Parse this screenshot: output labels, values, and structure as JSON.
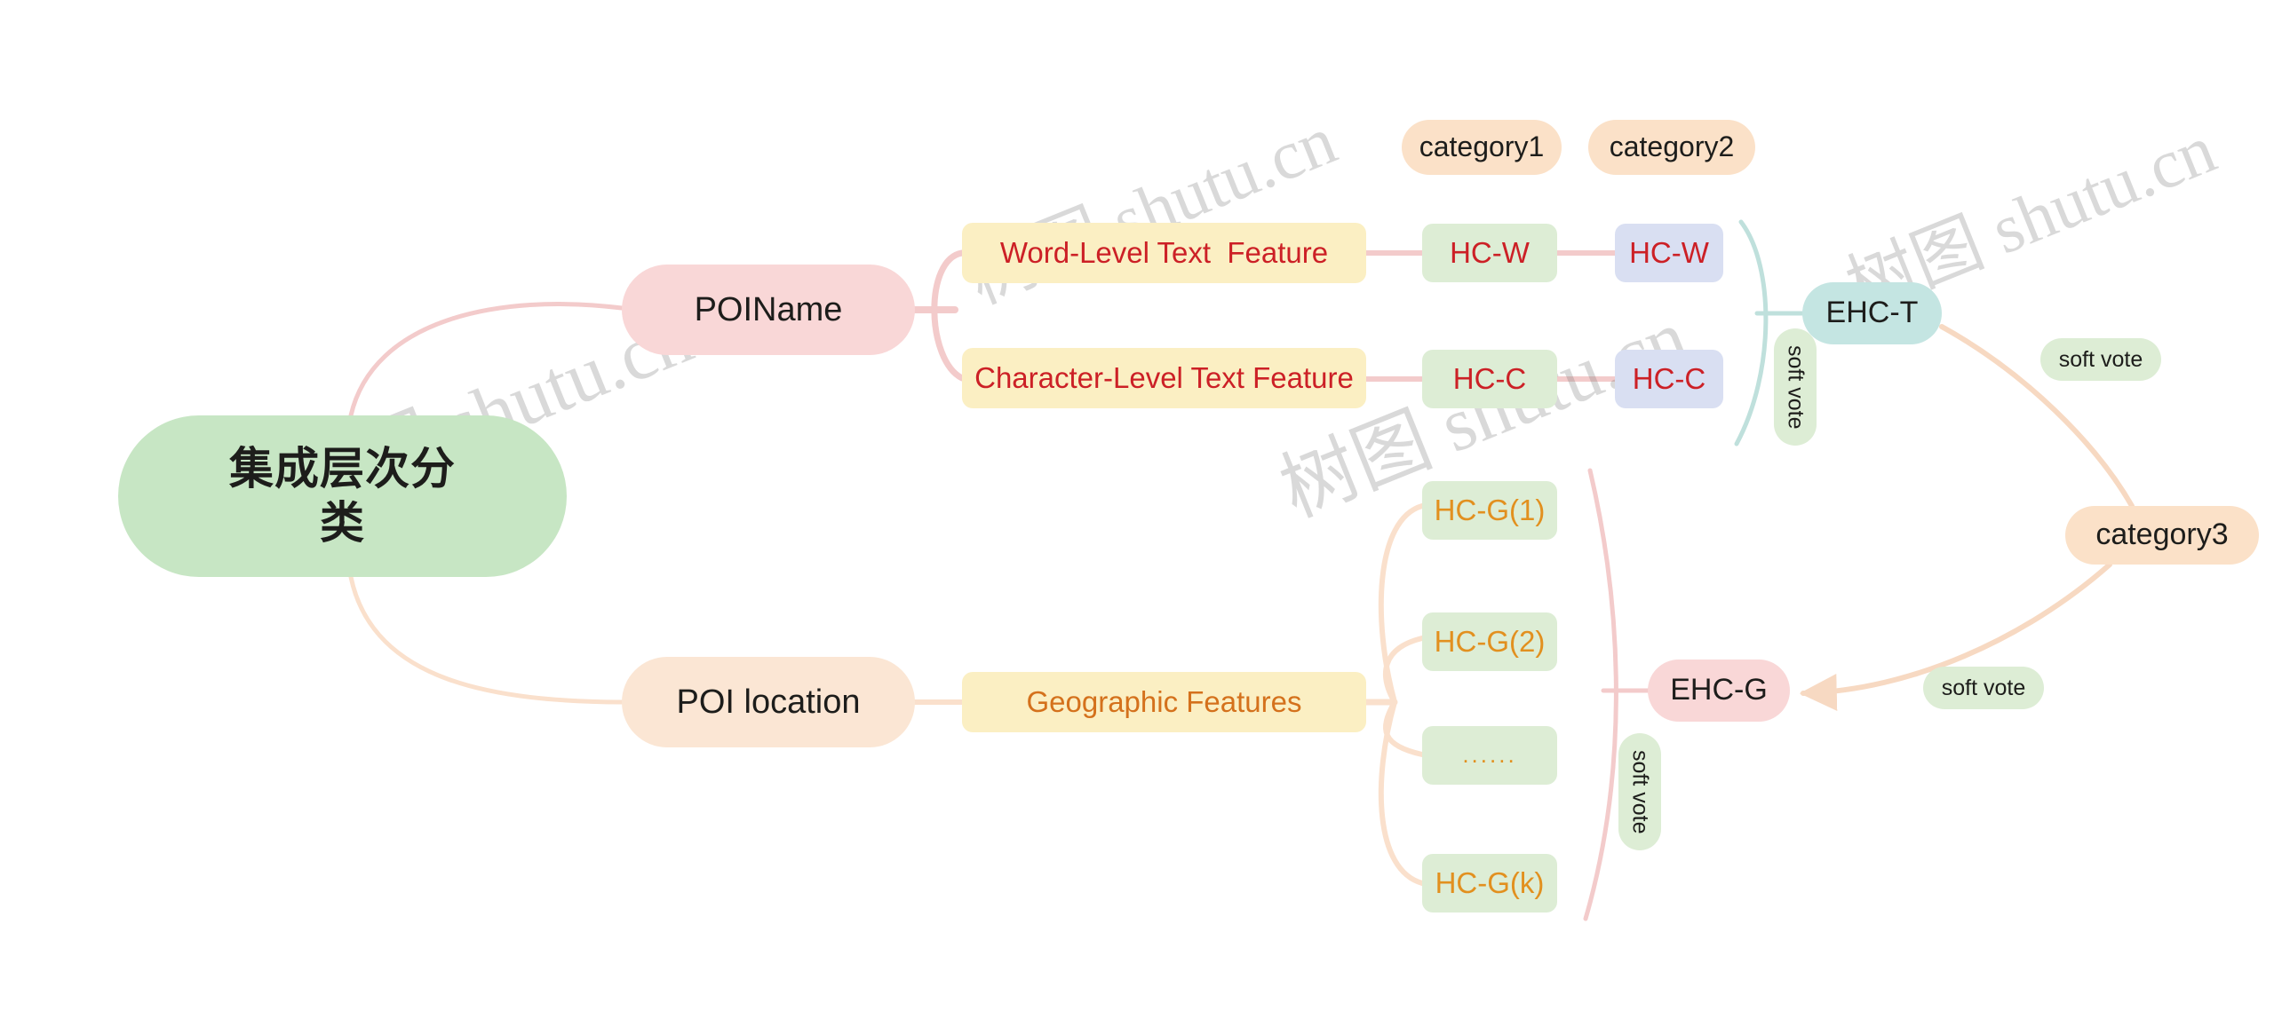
{
  "diagram": {
    "title": "集成层次分类",
    "watermark": "树图 shutu.cn",
    "colors": {
      "root_fill": "#c7e6c4",
      "poiname_fill": "#f9d7d7",
      "poilocation_fill": "#fbe6d4",
      "feature_fill": "#fbefc3",
      "hc_fill": "#ddedd5",
      "hc_blue_fill": "#d9dff2",
      "ehct_fill": "#c4e5e2",
      "ehcg_fill": "#f9d7d7",
      "category_fill": "#fbe1c8",
      "softvote_fill": "#ddedd5",
      "text_red": "#cc2026",
      "text_orange": "#d4711c",
      "text_amber": "#e2901f",
      "edge_pink": "#f3cbcb",
      "edge_peach": "#fae0cc",
      "edge_teal": "#bfe0dc",
      "edge_arrow": "#f7d9c2"
    }
  },
  "root": {
    "label": "集成层次分\n类"
  },
  "branches": {
    "poiname": {
      "label": "POIName"
    },
    "poi_location": {
      "label": "POI location"
    }
  },
  "features": {
    "word_level": "Word-Level Text  Feature",
    "character_level": "Character-Level Text Feature",
    "geographic": "Geographic Features"
  },
  "classifiers": {
    "hc_w": "HC-W",
    "hc_c": "HC-C",
    "hc_w_blue": "HC-W",
    "hc_c_blue": "HC-C",
    "hc_g_1": "HC-G(1)",
    "hc_g_2": "HC-G(2)",
    "hc_g_dots": "......",
    "hc_g_k": "HC-G(k)"
  },
  "ensembles": {
    "ehc_t": "EHC-T",
    "ehc_g": "EHC-G"
  },
  "categories": {
    "category1": "category1",
    "category2": "category2",
    "category3": "category3"
  },
  "soft_vote": {
    "text_vertical_t": "soft vote",
    "text_vertical_g": "soft vote",
    "text_right_top": "soft vote",
    "text_right_bottom": "soft vote"
  }
}
